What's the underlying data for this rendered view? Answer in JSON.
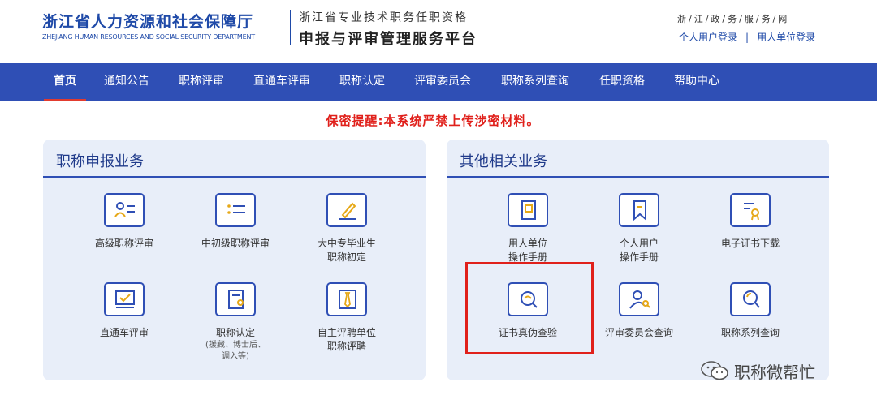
{
  "header": {
    "title": "浙江省人力资源和社会保障厅",
    "title_en": "ZHEJIANG HUMAN RESOURCES AND SOCIAL SECURITY DEPARTMENT",
    "platform_line1": "浙江省专业技术职务任职资格",
    "platform_line2": "申报与评审管理服务平台",
    "gov_net": "浙/江/政/务/服/务/网",
    "login_personal": "个人用户登录",
    "login_separator": "|",
    "login_employer": "用人单位登录"
  },
  "nav": {
    "items": [
      {
        "label": "首页",
        "active": true
      },
      {
        "label": "通知公告"
      },
      {
        "label": "职称评审"
      },
      {
        "label": "直通车评审"
      },
      {
        "label": "职称认定"
      },
      {
        "label": "评审委员会"
      },
      {
        "label": "职称系列查询"
      },
      {
        "label": "任职资格"
      },
      {
        "label": "帮助中心"
      }
    ]
  },
  "warning": "保密提醒:本系统严禁上传涉密材料。",
  "panels": {
    "left": {
      "title": "职称申报业务",
      "tiles": [
        {
          "label": "高级职称评审",
          "icon": "person-card-icon"
        },
        {
          "label": "中初级职称评审",
          "icon": "list-icon"
        },
        {
          "label": "大中专毕业生",
          "label2": "职称初定",
          "icon": "pencil-icon"
        },
        {
          "label": "直通车评审",
          "icon": "checked-box-icon"
        },
        {
          "label": "职称认定",
          "sub1": "(援藏、博士后、",
          "sub2": "调入等)",
          "icon": "document-person-icon"
        },
        {
          "label": "自主评聘单位",
          "label2": "职称评聘",
          "icon": "tie-icon"
        }
      ]
    },
    "right": {
      "title": "其他相关业务",
      "tiles": [
        {
          "label": "用人单位",
          "label2": "操作手册",
          "icon": "manual-icon"
        },
        {
          "label": "个人用户",
          "label2": "操作手册",
          "icon": "bookmark-icon"
        },
        {
          "label": "电子证书下载",
          "icon": "certificate-icon"
        },
        {
          "label": "证书真伪查验",
          "icon": "verify-search-icon"
        },
        {
          "label": "评审委员会查询",
          "icon": "person-search-icon"
        },
        {
          "label": "职称系列查询",
          "icon": "search-icon"
        }
      ]
    }
  },
  "watermark": "职称微帮忙",
  "colors": {
    "nav_bg": "#2f4fb5",
    "brand_blue": "#1f4aa8",
    "warning_red": "#e0201b",
    "panel_bg": "#e8eef9"
  }
}
